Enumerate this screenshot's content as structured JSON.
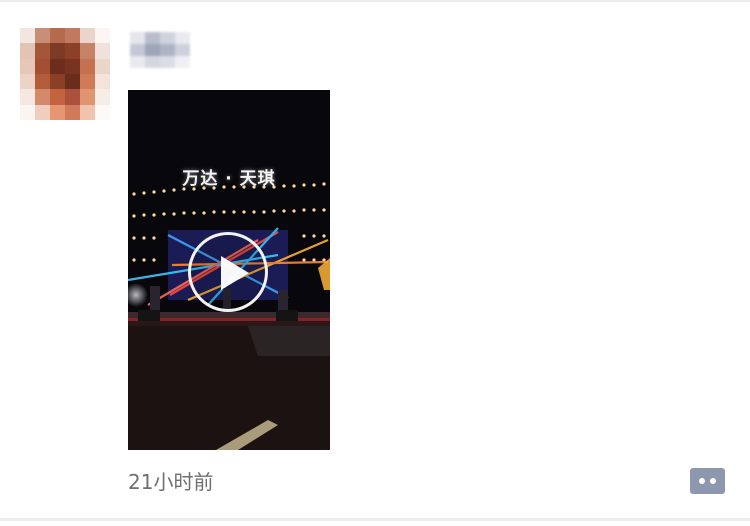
{
  "post": {
    "author_avatar": "blurred-avatar",
    "author_name": "",
    "video": {
      "stage_title": "万达 · 天琪",
      "play_icon": "play-icon"
    },
    "timestamp": "21小时前",
    "comment_icon": "comment-dots-icon"
  },
  "colors": {
    "timestamp": "#6f6f6f",
    "comment_button": "#8d97ad",
    "video_background": "#07070c"
  }
}
